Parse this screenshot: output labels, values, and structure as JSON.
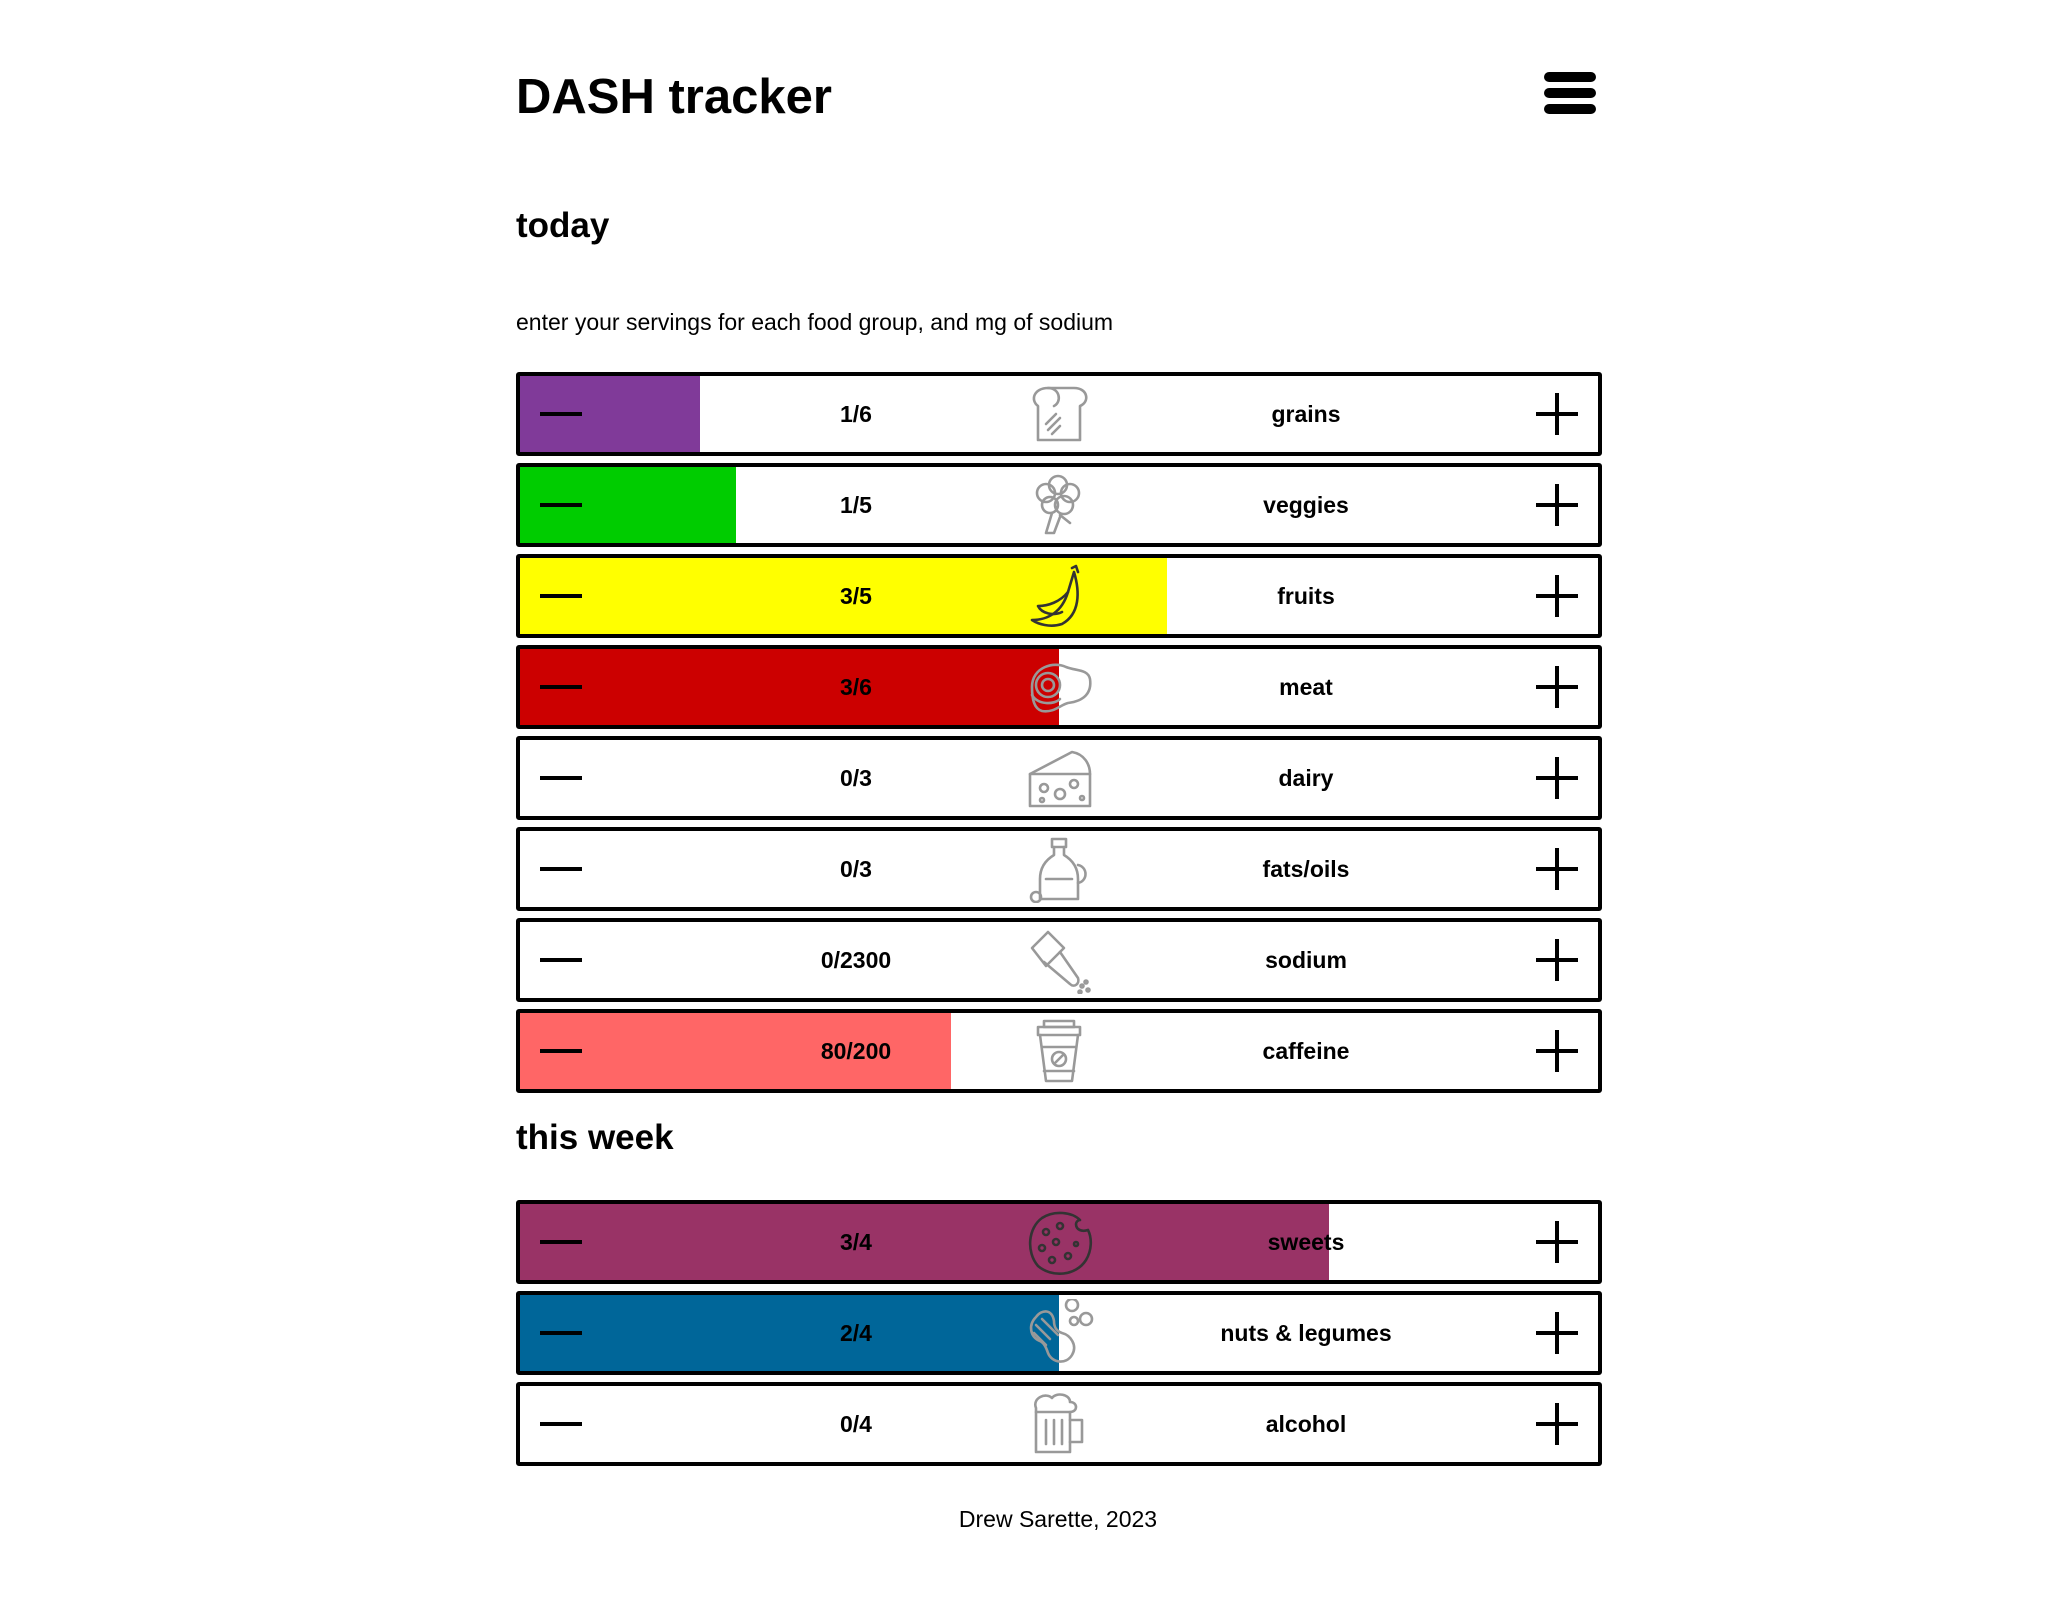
{
  "header": {
    "title": "DASH tracker",
    "menu_icon": "hamburger-menu-icon"
  },
  "today": {
    "heading": "today",
    "instructions": "enter your servings for each food group, and mg of sodium",
    "items": [
      {
        "label": "grains",
        "count_text": "1/6",
        "value": 1,
        "target": 6,
        "color": "#803a99",
        "icon": "bread-icon"
      },
      {
        "label": "veggies",
        "count_text": "1/5",
        "value": 1,
        "target": 5,
        "color": "#00cc00",
        "icon": "broccoli-icon"
      },
      {
        "label": "fruits",
        "count_text": "3/5",
        "value": 3,
        "target": 5,
        "color": "#ffff00",
        "icon": "banana-icon"
      },
      {
        "label": "meat",
        "count_text": "3/6",
        "value": 3,
        "target": 6,
        "color": "#cc0000",
        "icon": "steak-icon"
      },
      {
        "label": "dairy",
        "count_text": "0/3",
        "value": 0,
        "target": 3,
        "color": "#999999",
        "icon": "cheese-icon"
      },
      {
        "label": "fats/oils",
        "count_text": "0/3",
        "value": 0,
        "target": 3,
        "color": "#999999",
        "icon": "oil-bottle-icon"
      },
      {
        "label": "sodium",
        "count_text": "0/2300",
        "value": 0,
        "target": 2300,
        "color": "#999999",
        "icon": "salt-shaker-icon"
      },
      {
        "label": "caffeine",
        "count_text": "80/200",
        "value": 80,
        "target": 200,
        "color": "#ff6666",
        "icon": "coffee-cup-icon"
      }
    ]
  },
  "week": {
    "heading": "this week",
    "items": [
      {
        "label": "sweets",
        "count_text": "3/4",
        "value": 3,
        "target": 4,
        "color": "#993366",
        "icon": "cookie-icon"
      },
      {
        "label": "nuts & legumes",
        "count_text": "2/4",
        "value": 2,
        "target": 4,
        "color": "#006699",
        "icon": "peanut-icon"
      },
      {
        "label": "alcohol",
        "count_text": "0/4",
        "value": 0,
        "target": 4,
        "color": "#999999",
        "icon": "beer-mug-icon"
      }
    ]
  },
  "footer": {
    "text": "Drew Sarette, 2023"
  }
}
